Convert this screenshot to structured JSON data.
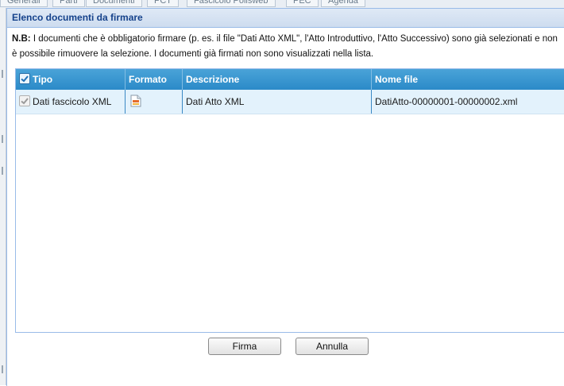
{
  "background_tabs": [
    "Generali",
    "Parti",
    "Documenti",
    "PCT",
    "Fascicolo Polisweb",
    "PEC",
    "Agenda"
  ],
  "dialog": {
    "title": "Elenco documenti da firmare",
    "note_bold": "N.B:",
    "note_text": " I documenti che è obbligatorio firmare (p. es. il file \"Dati Atto XML\", l'Atto Introduttivo, l'Atto Successivo) sono già selezionati e non è possibile rimuovere la selezione. I documenti già firmati non sono visualizzati nella lista."
  },
  "grid": {
    "header_checked": true,
    "columns": [
      "Tipo",
      "Formato",
      "Descrizione",
      "Nome file"
    ],
    "rows": [
      {
        "tipo": "Dati fascicolo XML",
        "checked": true,
        "formato_icon": "xml-file-icon",
        "descrizione": "Dati Atto XML",
        "nome_file": "DatiAtto-00000001-00000002.xml"
      }
    ]
  },
  "buttons": {
    "firma": "Firma",
    "annulla": "Annulla"
  },
  "colors": {
    "header_blue": "#2b8ac8",
    "row_bg": "#e3f2fc",
    "title_text": "#15428b"
  }
}
